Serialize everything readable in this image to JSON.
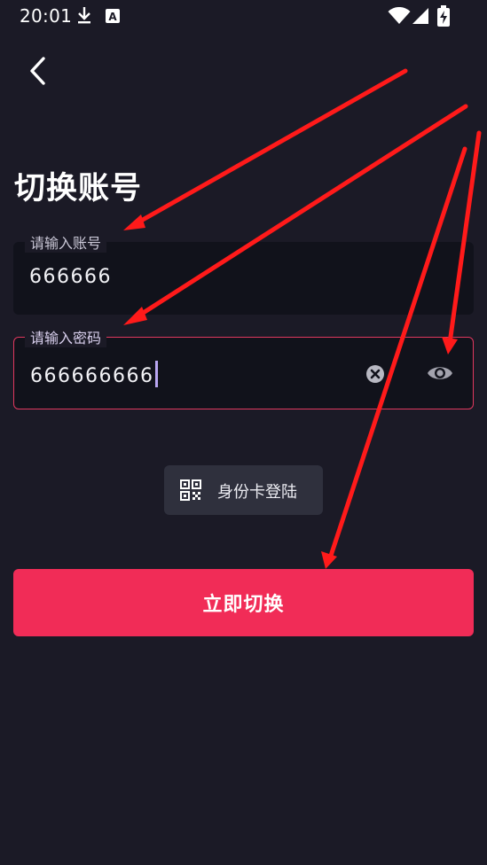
{
  "status_bar": {
    "time": "20:01",
    "icons": [
      "download-icon",
      "a-icon",
      "wifi-icon",
      "signal-icon",
      "battery-charging-icon"
    ]
  },
  "nav": {
    "back_icon": "chevron-left-icon"
  },
  "title": "切换账号",
  "account_field": {
    "label": "请输入账号",
    "value": "666666"
  },
  "password_field": {
    "label": "请输入密码",
    "value": "666666666",
    "clear_icon": "clear-circle-icon",
    "visibility_icon": "eye-icon"
  },
  "idcard_login": {
    "label": "身份卡登陆",
    "icon": "qr-code-icon"
  },
  "submit": {
    "label": "立即切换"
  },
  "colors": {
    "background": "#1b1a26",
    "field_background": "#11121b",
    "accent": "#f12c57",
    "focus_border": "#e0385f",
    "annotation_arrow": "#ff1a1a"
  }
}
